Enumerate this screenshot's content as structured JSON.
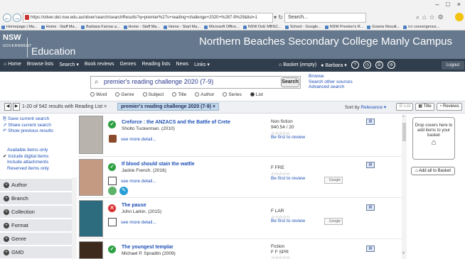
{
  "browser": {
    "window_controls": [
      "–",
      "□",
      "×"
    ],
    "url": "https://oliver.det.nsw.edu.au/oliver/search/searchResults?q=premier%27s+reading+challenge+2020+%287-9%29&list=1",
    "search_box": "Search...",
    "bookmarks": [
      "Homepage | Ma...",
      "Home - Staff Ma...",
      "Barbara Farrow a...",
      "Home - Staff Ma...",
      "Home - Start Ma...",
      "Microsoft Office...",
      "NSW DoE MBSC...",
      "School - Google...",
      "NSW Premier's R...",
      "Gowns Result...",
      "rcr convergence..."
    ]
  },
  "header": {
    "logo_text": "NSW",
    "logo_sub": "GOVERNMENT",
    "edu_label": "Education",
    "school_name": "Northern Beaches Secondary College Manly Campus"
  },
  "nav": {
    "items": [
      "Home",
      "Browse lists",
      "Search ▾",
      "Book reviews",
      "Genres",
      "Reading lists",
      "News",
      "Links ▾"
    ],
    "basket": "Basket (empty)",
    "user": "Barbara ▾",
    "logout": "Logout"
  },
  "search": {
    "query": "premier's reading challenge 2020 (7-9)",
    "button": "Search",
    "links": [
      "Browse",
      "Search other sources",
      "Advanced search"
    ],
    "options": [
      {
        "label": "Word",
        "selected": false
      },
      {
        "label": "Genre",
        "selected": false
      },
      {
        "label": "Subject",
        "selected": false
      },
      {
        "label": "Title",
        "selected": false
      },
      {
        "label": "Author",
        "selected": false
      },
      {
        "label": "Series",
        "selected": false
      },
      {
        "label": "List",
        "selected": true
      }
    ]
  },
  "results_bar": {
    "prev": "◀",
    "next": "▶",
    "summary": "1-20 of 542 results with Reading List =",
    "list_tag": "premier's reading challenge 2020 (7-9) ×",
    "sort_label": "Sort by",
    "sort_value": "Relevance ▾",
    "views": [
      "List",
      "Title",
      "Reviews"
    ]
  },
  "sidebar": {
    "links": [
      "Save current search",
      "Share current search",
      "Show previous results"
    ],
    "availability": [
      "Available items only",
      "Include digital items",
      "Include attachments",
      "Reserved items only"
    ],
    "facets": [
      "Author",
      "Branch",
      "Collection",
      "Format",
      "Genre",
      "GMD"
    ]
  },
  "results": [
    {
      "title": "Creforce : the ANZACS and the Battle of Crete",
      "author": "Sholto Tuckerman. (2010)",
      "detail": "see more detail...",
      "call_lines": [
        "Non fiction",
        "940.54 / 20"
      ],
      "stars": "☆☆☆☆☆",
      "review": "Be first to review",
      "status": "available",
      "cover_color": "#b8b4ad",
      "google": false
    },
    {
      "title": "If blood should stain the wattle",
      "author": "Jackie French. (2016)",
      "detail": "see more detail...",
      "call_lines": [
        "F FRE"
      ],
      "stars": "☆☆☆☆☆",
      "review": "Be first to review",
      "status": "available",
      "cover_color": "#c59a83",
      "google": true
    },
    {
      "title": "The pause",
      "author": "John Larkin. (2015)",
      "detail": "see more detail...",
      "call_lines": [
        "F LAR"
      ],
      "stars": "☆☆☆☆☆",
      "review": "Be first to review",
      "status": "unavailable",
      "cover_color": "#2d6b7f",
      "google": true
    },
    {
      "title": "The youngest templar",
      "author": "Michael P. Spradlin (2009)",
      "detail": "",
      "call_lines": [
        "Fiction",
        "F F SPR"
      ],
      "stars": "☆☆☆☆☆",
      "review": "",
      "status": "available",
      "cover_color": "#3d2a1c",
      "google": false
    }
  ],
  "right_panel": {
    "drop_text": "Drop covers here to add items to your basket",
    "basket_glyph": "⌂",
    "add_all": "Add all to Basket"
  },
  "colors": {
    "header": "#66788d",
    "navbar": "#303d4c",
    "link": "#1d4fb6",
    "available": "#2ea043",
    "unavailable": "#d93131"
  }
}
